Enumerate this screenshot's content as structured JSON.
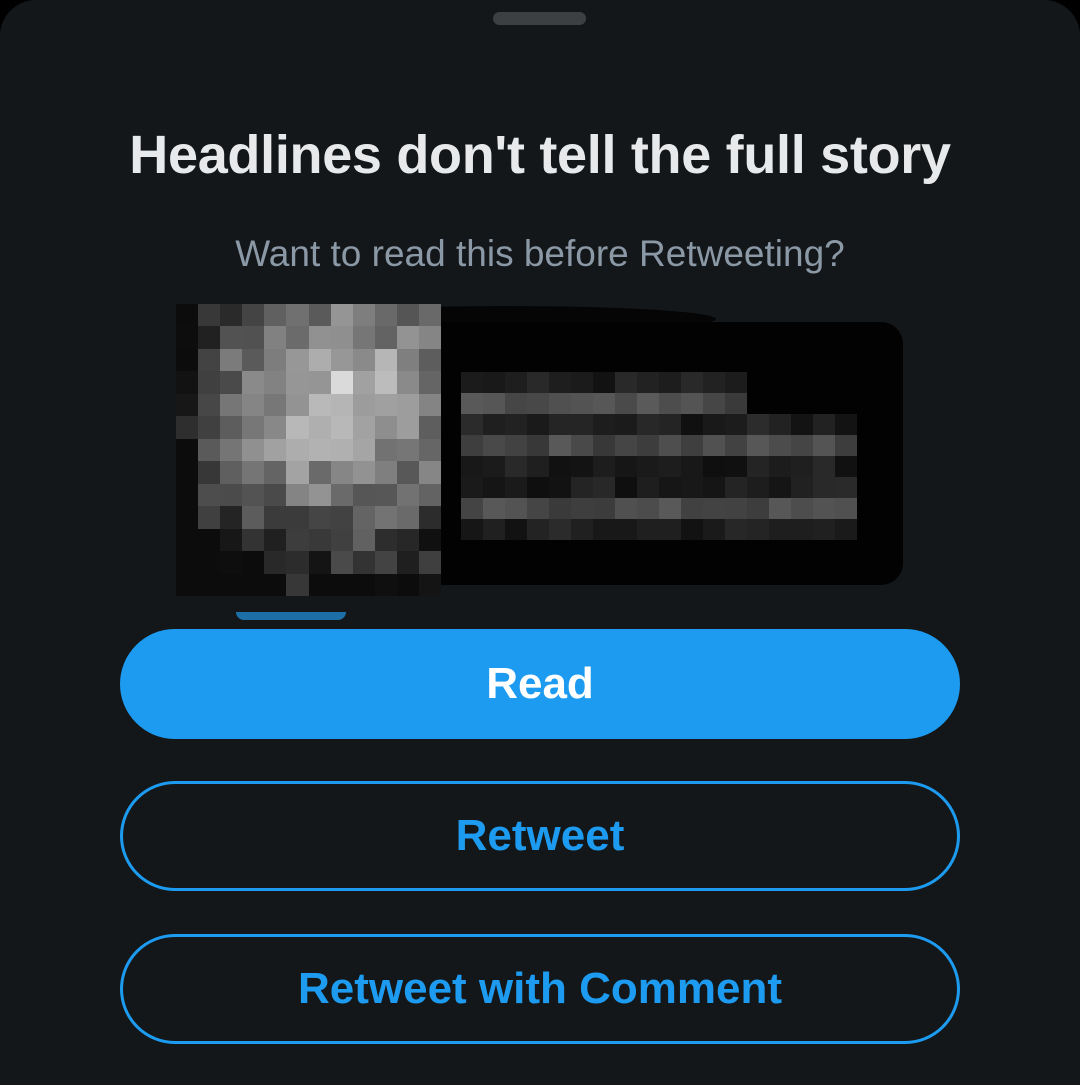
{
  "prompt": {
    "title": "Headlines don't tell the full story",
    "subtitle": "Want to read this before Retweeting?"
  },
  "link_card": {
    "redacted": true
  },
  "actions": {
    "read_label": "Read",
    "retweet_label": "Retweet",
    "retweet_with_comment_label": "Retweet with Comment"
  },
  "colors": {
    "background": "#14171a",
    "title": "#e7e9ea",
    "subtitle": "#8b98a5",
    "accent": "#1d9bf0",
    "grabber": "#3d4043"
  }
}
